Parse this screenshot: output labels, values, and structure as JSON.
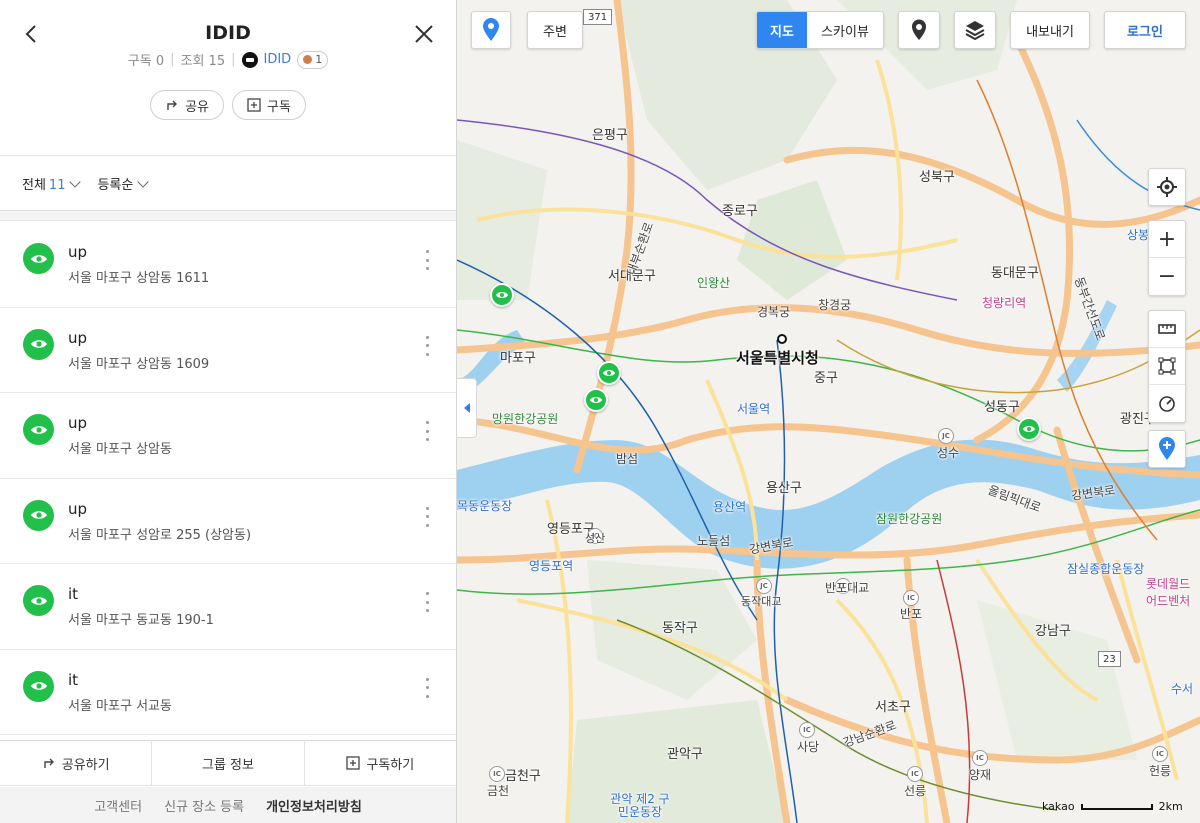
{
  "header": {
    "title": "IDID",
    "subscribers_label": "구독 0",
    "views_label": "조회 15",
    "owner_name": "IDID",
    "level": "1",
    "share_label": "공유",
    "subscribe_label": "구독"
  },
  "filter": {
    "all_label": "전체",
    "count": "11",
    "sort_label": "등록순"
  },
  "places": [
    {
      "name": "up",
      "address": "서울 마포구 상암동 1611"
    },
    {
      "name": "up",
      "address": "서울 마포구 상암동 1609"
    },
    {
      "name": "up",
      "address": "서울 마포구 상암동"
    },
    {
      "name": "up",
      "address": "서울 마포구 성암로 255 (상암동)"
    },
    {
      "name": "it",
      "address": "서울 마포구 동교동 190-1"
    },
    {
      "name": "it",
      "address": "서울 마포구 서교동"
    }
  ],
  "bottom_actions": {
    "share": "공유하기",
    "group_info": "그룹 정보",
    "subscribe": "구독하기"
  },
  "footer": {
    "support": "고객센터",
    "register": "신규 장소 등록",
    "privacy": "개인정보처리방침"
  },
  "map_controls": {
    "nearby": "주변",
    "map": "지도",
    "skyview": "스카이뷰",
    "export": "내보내기",
    "login": "로그인",
    "scale": "2km",
    "brand": "kakao",
    "route_371": "371",
    "route_23": "23"
  },
  "map_labels": {
    "eunpyeong": "은평구",
    "seongbuk": "성북구",
    "jongno": "종로구",
    "seodaemun": "서대문구",
    "inwangsan": "인왕산",
    "gyeongbokgung": "경복궁",
    "changgyeonggung": "창경궁",
    "dongdaemun": "동대문구",
    "cheongnyangni": "청량리역",
    "mapo": "마포구",
    "seoul_city_hall": "서울특별시청",
    "junggu": "중구",
    "seoul_station": "서울역",
    "mangwon_park": "망원한강공원",
    "seongdong": "성동구",
    "gwangjin": "광진구",
    "bamseom": "밤섬",
    "seongsu": "성수",
    "yongsan": "용산구",
    "yongsan_station": "용산역",
    "jamwon_park": "잠원한강공원",
    "yeongdeungpo": "영등포구",
    "nodeulseom": "노들섬",
    "gangbyeonbukro": "강변북로",
    "olympic_daero": "올림픽대로",
    "yeongdeungpo_station": "영등포역",
    "dongjak_bridge": "동작대교",
    "banpo_bridge": "반포대교",
    "banpo": "반포",
    "jamsil_stadium": "잠실종합운동장",
    "lotte_world": "롯데월드 어드벤처",
    "dongjak": "동작구",
    "gangnam": "강남구",
    "seocho": "서초구",
    "gwanak": "관악구",
    "sadang": "사당",
    "gangnam_sunhwanro": "강남순환로",
    "yangjae": "양재",
    "seonreung": "선릉",
    "geumcheon": "금천구",
    "geumcheon2": "금천",
    "gwanak2_gym": "관악 제2 구민운동장",
    "hyeonreung": "헌릉",
    "susseo": "수서",
    "sangbong": "상봉역",
    "naebu_expressway": "내부순환로",
    "dongbu_expressway": "동부간선도로",
    "gangbyeonbuk": "강변북로",
    "mokdong_stadium": "목동운동장",
    "seongsan": "성산"
  }
}
